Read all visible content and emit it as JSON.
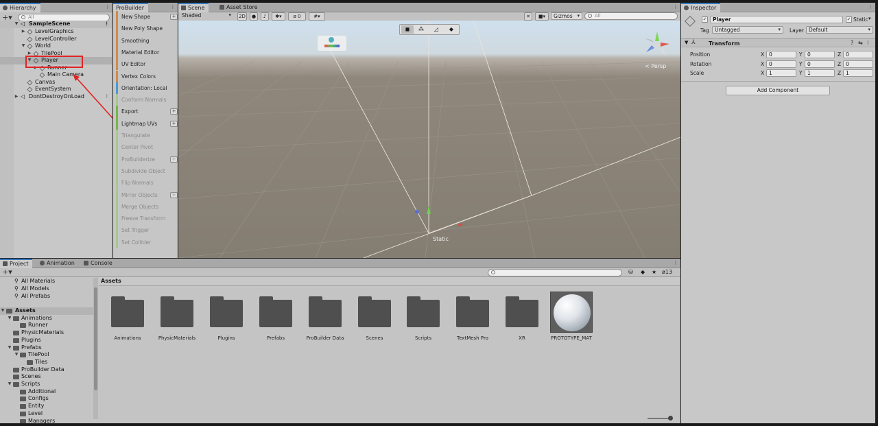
{
  "hierarchy": {
    "tab": "Hierarchy",
    "search_placeholder": "All",
    "items": [
      {
        "label": "SampleScene"
      },
      {
        "label": "LevelGraphics"
      },
      {
        "label": "LevelController"
      },
      {
        "label": "World"
      },
      {
        "label": "TilePool"
      },
      {
        "label": "Player"
      },
      {
        "label": "Runner"
      },
      {
        "label": "Main Camera"
      },
      {
        "label": "Canvas"
      },
      {
        "label": "EventSystem"
      },
      {
        "label": "DontDestroyOnLoad"
      }
    ]
  },
  "probuilder": {
    "tab": "ProBuilder",
    "items": [
      {
        "label": "New Shape"
      },
      {
        "label": "New Poly Shape"
      },
      {
        "label": "Smoothing"
      },
      {
        "label": "Material Editor"
      },
      {
        "label": "UV Editor"
      },
      {
        "label": "Vertex Colors"
      },
      {
        "label": "Orientation: Local"
      },
      {
        "label": "Conform Normals"
      },
      {
        "label": "Export"
      },
      {
        "label": "Lightmap UVs"
      },
      {
        "label": "Triangulate"
      },
      {
        "label": "Center Pivot"
      },
      {
        "label": "ProBuilderize"
      },
      {
        "label": "Subdivide Object"
      },
      {
        "label": "Flip Normals"
      },
      {
        "label": "Mirror Objects"
      },
      {
        "label": "Merge Objects"
      },
      {
        "label": "Freeze Transform"
      },
      {
        "label": "Set Trigger"
      },
      {
        "label": "Set Collider"
      }
    ],
    "plus": "+"
  },
  "scene": {
    "tabs": [
      "Scene",
      "Asset Store"
    ],
    "shading": "Shaded",
    "mode_2d": "2D",
    "fx_count": "0",
    "gizmos": "Gizmos",
    "search_placeholder": "All",
    "persp": "< Persp",
    "static_label": "Static"
  },
  "bottom": {
    "tabs": [
      "Project",
      "Animation",
      "Console"
    ],
    "hidden_count": "13",
    "favorites": [
      "All Materials",
      "All Models",
      "All Prefabs"
    ],
    "tree": [
      {
        "label": "Assets"
      },
      {
        "label": "Animations"
      },
      {
        "label": "Runner"
      },
      {
        "label": "PhysicMaterials"
      },
      {
        "label": "Plugins"
      },
      {
        "label": "Prefabs"
      },
      {
        "label": "TilePool"
      },
      {
        "label": "Tiles"
      },
      {
        "label": "ProBuilder Data"
      },
      {
        "label": "Scenes"
      },
      {
        "label": "Scripts"
      },
      {
        "label": "Additional"
      },
      {
        "label": "Configs"
      },
      {
        "label": "Entity"
      },
      {
        "label": "Level"
      },
      {
        "label": "Managers"
      }
    ],
    "breadcrumb": "Assets",
    "assets": [
      "Animations",
      "PhysicMaterials",
      "Plugins",
      "Prefabs",
      "ProBuilder Data",
      "Scenes",
      "Scripts",
      "TextMesh Pro",
      "XR",
      "PROTOTYPE_MAT"
    ]
  },
  "inspector": {
    "tab": "Inspector",
    "object_name": "Player",
    "static_label": "Static",
    "tag_label": "Tag",
    "tag_value": "Untagged",
    "layer_label": "Layer",
    "layer_value": "Default",
    "component": "Transform",
    "rows": [
      {
        "label": "Position",
        "x": "0",
        "y": "0",
        "z": "0"
      },
      {
        "label": "Rotation",
        "x": "0",
        "y": "0",
        "z": "0"
      },
      {
        "label": "Scale",
        "x": "1",
        "y": "1",
        "z": "1"
      }
    ],
    "axis": [
      "X",
      "Y",
      "Z"
    ],
    "add_component": "Add Component"
  },
  "colors": {
    "highlight": "#e02424",
    "accent": "#3a79bb"
  }
}
